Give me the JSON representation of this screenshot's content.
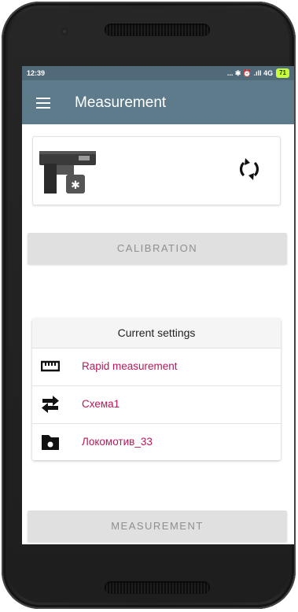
{
  "status_bar": {
    "time": "12:39",
    "icons": "... ✱ ⏰ .ıll 4G",
    "battery": "71"
  },
  "app_bar": {
    "title": "Measurement",
    "color": "#5e7b8c"
  },
  "device_card": {
    "device_icon": "meter-device-with-bluetooth-icon",
    "refresh_icon": "refresh-icon"
  },
  "buttons": {
    "calibration": "CALIBRATION",
    "measurement": "MEASUREMENT"
  },
  "settings": {
    "header": "Current settings",
    "items": [
      {
        "icon": "ruler-icon",
        "label": "Rapid measurement"
      },
      {
        "icon": "swap-arrows-icon",
        "label": "Схема1"
      },
      {
        "icon": "folder-icon",
        "label": "Локомотив_33"
      }
    ],
    "label_color": "#b8175a"
  }
}
